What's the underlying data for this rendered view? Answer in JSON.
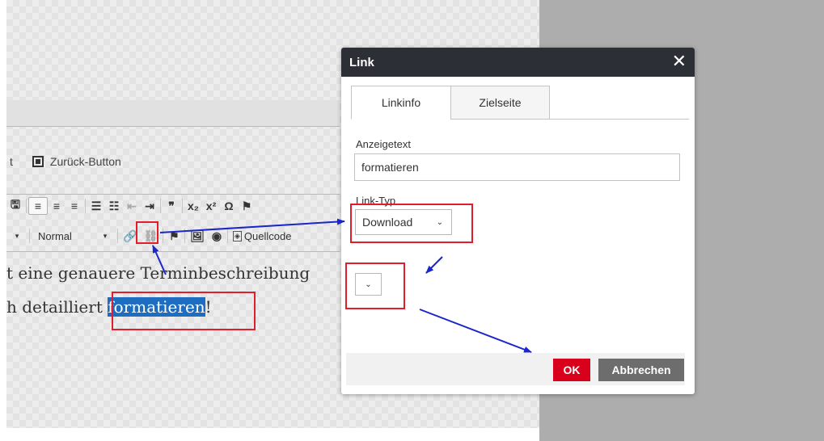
{
  "editor": {
    "zurueck_prefix": "t",
    "zurueck_label": "Zurück-Button",
    "toolbar1": [
      {
        "id": "save",
        "glyph": "🖫",
        "name": "save-icon"
      },
      {
        "sep": true
      },
      {
        "id": "align-left",
        "glyph": "≡",
        "name": "align-left-icon",
        "active": true
      },
      {
        "id": "align-center",
        "glyph": "≡",
        "name": "align-center-icon"
      },
      {
        "id": "align-right",
        "glyph": "≡",
        "name": "align-right-icon"
      },
      {
        "sep": true
      },
      {
        "id": "bullets",
        "glyph": "☰",
        "name": "bulleted-list-icon"
      },
      {
        "id": "numbers",
        "glyph": "☷",
        "name": "numbered-list-icon"
      },
      {
        "id": "outdent",
        "glyph": "⇤",
        "name": "outdent-icon",
        "muted": true
      },
      {
        "id": "indent",
        "glyph": "⇥",
        "name": "indent-icon"
      },
      {
        "sep": true
      },
      {
        "id": "quote",
        "glyph": "❞",
        "name": "blockquote-icon"
      },
      {
        "sep": true
      },
      {
        "id": "subscript",
        "glyph": "x₂",
        "name": "subscript-icon"
      },
      {
        "id": "superscript",
        "glyph": "x²",
        "name": "superscript-icon"
      },
      {
        "id": "special",
        "glyph": "Ω",
        "name": "special-character-icon"
      },
      {
        "id": "flag",
        "glyph": "⚑",
        "name": "anchor-flag-icon"
      }
    ],
    "format_label": "Normal",
    "toolbar2_icons": [
      {
        "id": "link",
        "glyph": "🔗",
        "name": "link-icon"
      },
      {
        "id": "unlink",
        "glyph": "⛓",
        "name": "unlink-icon",
        "muted": true
      },
      {
        "sep": true
      },
      {
        "id": "anchor",
        "glyph": "⚑",
        "name": "anchor-icon"
      },
      {
        "sep": true
      },
      {
        "id": "image",
        "glyph": "🖼",
        "name": "image-icon"
      },
      {
        "id": "embed",
        "glyph": "◉",
        "name": "media-embed-icon"
      },
      {
        "sep": true
      }
    ],
    "source_label": "Quellcode",
    "content_line1": "t eine genauere Terminbeschreibung",
    "content_line2_before": "h detailliert ",
    "content_line2_selected": "formatieren",
    "content_line2_after": "!"
  },
  "dialog": {
    "title": "Link",
    "close_glyph": "✕",
    "tabs": [
      {
        "label": "Linkinfo"
      },
      {
        "label": "Zielseite"
      }
    ],
    "display_text_label": "Anzeigetext",
    "display_text_value": "formatieren",
    "link_type_label": "Link-Typ",
    "link_type_value": "Download",
    "chevron": "⌄",
    "second_select_value": "",
    "ok_label": "OK",
    "cancel_label": "Abbrechen"
  },
  "colors": {
    "annotation_red": "#e11d2c",
    "annotation_arrow": "#1a26c9",
    "selection": "#1f6dc1",
    "ok_button": "#d9001b"
  }
}
